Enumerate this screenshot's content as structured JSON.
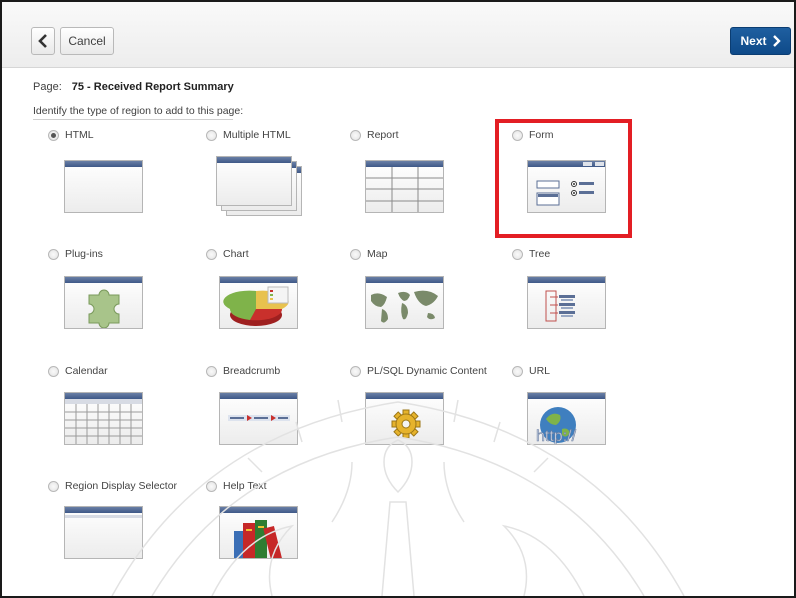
{
  "toolbar": {
    "back_icon": "chevron-left-icon",
    "cancel_label": "Cancel",
    "next_label": "Next",
    "next_icon": "chevron-right-icon",
    "accent": "#0e4a89"
  },
  "page": {
    "label": "Page:",
    "value": "75 - Received Report Summary",
    "instruction": "Identify the type of region to add to this page:"
  },
  "region_types": [
    {
      "label": "HTML",
      "selected": true,
      "icon": "html-region-icon"
    },
    {
      "label": "Multiple HTML",
      "selected": false,
      "icon": "multiple-html-icon"
    },
    {
      "label": "Report",
      "selected": false,
      "icon": "report-table-icon"
    },
    {
      "label": "Form",
      "selected": false,
      "icon": "form-icon",
      "highlighted": true
    },
    {
      "label": "Plug-ins",
      "selected": false,
      "icon": "puzzle-piece-icon"
    },
    {
      "label": "Chart",
      "selected": false,
      "icon": "pie-chart-icon"
    },
    {
      "label": "Map",
      "selected": false,
      "icon": "world-map-icon"
    },
    {
      "label": "Tree",
      "selected": false,
      "icon": "tree-icon"
    },
    {
      "label": "Calendar",
      "selected": false,
      "icon": "calendar-grid-icon"
    },
    {
      "label": "Breadcrumb",
      "selected": false,
      "icon": "breadcrumb-icon"
    },
    {
      "label": "PL/SQL Dynamic Content",
      "selected": false,
      "icon": "gear-icon"
    },
    {
      "label": "URL",
      "selected": false,
      "icon": "globe-http-icon"
    },
    {
      "label": "Region Display Selector",
      "selected": false,
      "icon": "region-selector-icon"
    },
    {
      "label": "Help Text",
      "selected": false,
      "icon": "books-icon"
    }
  ],
  "thumb_text": {
    "url": "http://"
  },
  "colors": {
    "highlight": "#e31e24",
    "thumb_header": "#3e5888"
  }
}
